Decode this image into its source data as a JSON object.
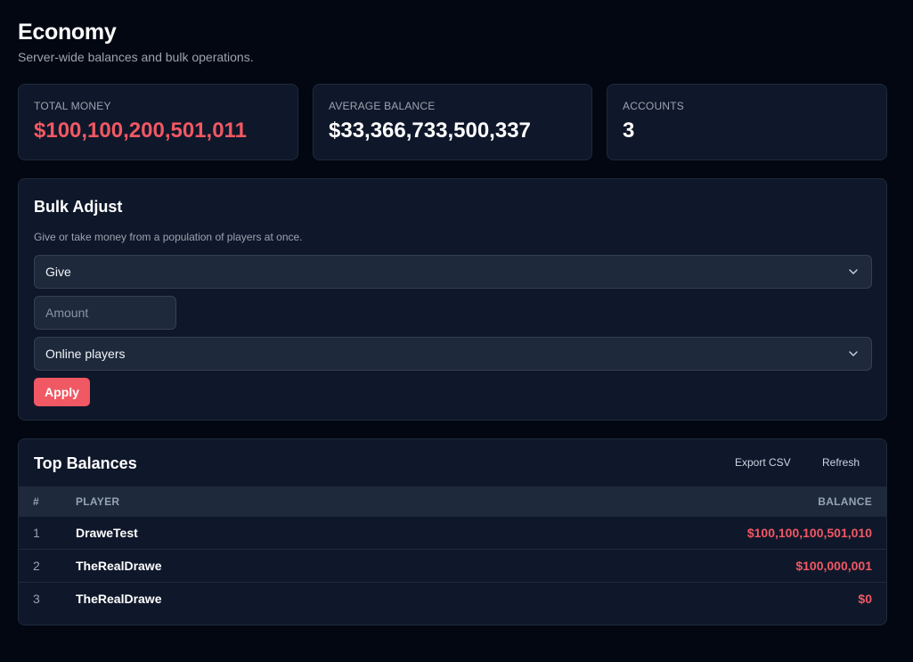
{
  "header": {
    "title": "Economy",
    "subtitle": "Server-wide balances and bulk operations."
  },
  "stats": [
    {
      "label": "TOTAL MONEY",
      "value": "$100,100,200,501,011"
    },
    {
      "label": "AVERAGE BALANCE",
      "value": "$33,366,733,500,337"
    },
    {
      "label": "ACCOUNTS",
      "value": "3"
    }
  ],
  "bulk_adjust": {
    "title": "Bulk Adjust",
    "description": "Give or take money from a population of players at once.",
    "action_selected": "Give",
    "amount_placeholder": "Amount",
    "target_selected": "Online players",
    "apply_label": "Apply"
  },
  "top_balances": {
    "title": "Top Balances",
    "export_label": "Export CSV",
    "refresh_label": "Refresh",
    "columns": {
      "rank": "#",
      "player": "PLAYER",
      "balance": "BALANCE"
    },
    "rows": [
      {
        "rank": "1",
        "player": "DraweTest",
        "balance": "$100,100,100,501,010"
      },
      {
        "rank": "2",
        "player": "TheRealDrawe",
        "balance": "$100,000,001"
      },
      {
        "rank": "3",
        "player": "TheRealDrawe",
        "balance": "$0"
      }
    ]
  },
  "colors": {
    "background": "#030712",
    "card": "#0f172a",
    "accent": "#f05863",
    "muted_text": "#9ca3af"
  },
  "icons": {
    "select_chevron": "chevron-down-icon"
  }
}
